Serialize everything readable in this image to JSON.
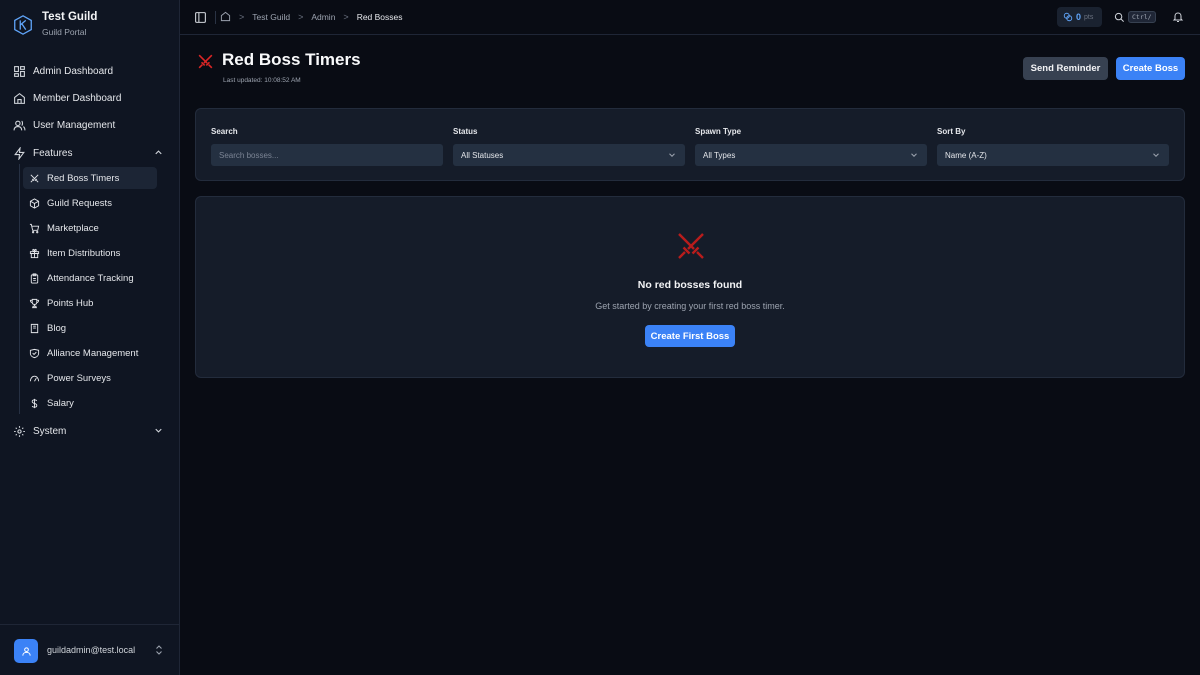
{
  "brand": {
    "title": "Test Guild",
    "subtitle": "Guild Portal"
  },
  "sidebar": {
    "items": [
      {
        "label": "Admin Dashboard",
        "icon": "grid-icon"
      },
      {
        "label": "Member Dashboard",
        "icon": "home-icon"
      },
      {
        "label": "User Management",
        "icon": "users-icon"
      },
      {
        "label": "Features",
        "icon": "zap-icon",
        "expanded": true
      },
      {
        "label": "System",
        "icon": "gear-icon",
        "expanded": false
      }
    ],
    "features": [
      {
        "label": "Red Boss Timers",
        "icon": "crossed-swords-icon",
        "active": true
      },
      {
        "label": "Guild Requests",
        "icon": "package-icon"
      },
      {
        "label": "Marketplace",
        "icon": "cart-icon"
      },
      {
        "label": "Item Distributions",
        "icon": "gift-icon"
      },
      {
        "label": "Attendance Tracking",
        "icon": "clipboard-icon"
      },
      {
        "label": "Points Hub",
        "icon": "trophy-icon"
      },
      {
        "label": "Blog",
        "icon": "book-icon"
      },
      {
        "label": "Alliance Management",
        "icon": "handshake-icon"
      },
      {
        "label": "Power Surveys",
        "icon": "gauge-icon"
      },
      {
        "label": "Salary",
        "icon": "dollar-icon"
      }
    ]
  },
  "user": {
    "email": "guildadmin@test.local"
  },
  "topbar": {
    "breadcrumbs": [
      "Test Guild",
      "Admin",
      "Red Bosses"
    ],
    "points_value": "0",
    "points_unit": "pts",
    "shortcut": "Ctrl/"
  },
  "page": {
    "title": "Red Boss Timers",
    "last_updated": "Last updated: 10:08:52 AM",
    "send_reminder": "Send Reminder",
    "create_boss": "Create Boss"
  },
  "filters": {
    "search_label": "Search",
    "search_placeholder": "Search bosses...",
    "status_label": "Status",
    "status_value": "All Statuses",
    "spawn_label": "Spawn Type",
    "spawn_value": "All Types",
    "sort_label": "Sort By",
    "sort_value": "Name (A-Z)"
  },
  "empty": {
    "title": "No red bosses found",
    "subtitle": "Get started by creating your first red boss timer.",
    "button": "Create First Boss"
  },
  "colors": {
    "accent": "#3b82f6",
    "danger": "#dc2626",
    "bg": "#090c14",
    "card": "#151c29"
  }
}
